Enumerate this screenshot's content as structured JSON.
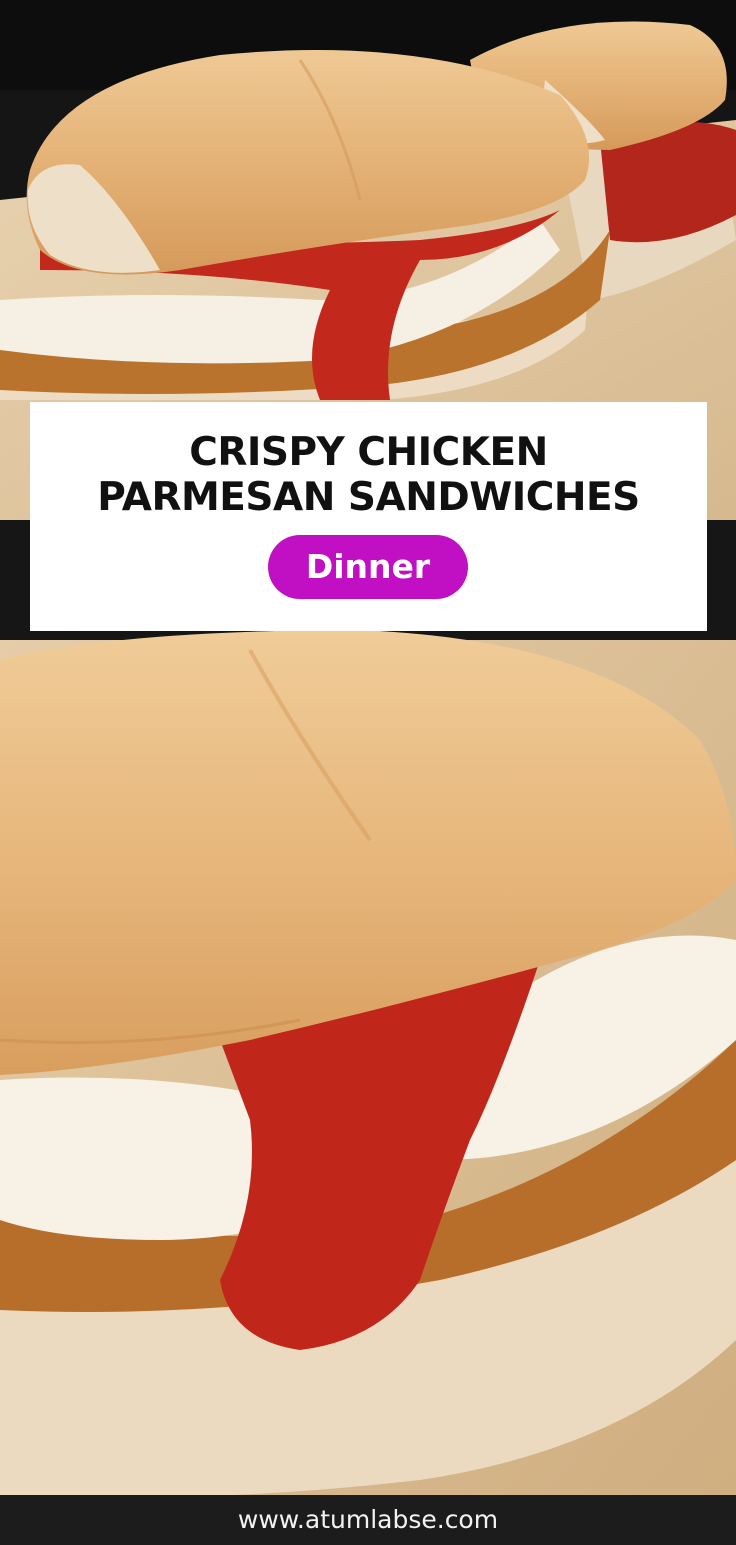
{
  "title": {
    "line1": "CRISPY CHICKEN",
    "line2": "PARMESAN SANDWICHES"
  },
  "category_badge": "Dinner",
  "footer": {
    "website": "www.atumlabse.com"
  },
  "colors": {
    "badge": "#c10fc4",
    "title_text": "#111111",
    "footer_bg": "#1c1c1c"
  },
  "images": {
    "top_photo": "chicken-parmesan-sandwiches-photo",
    "bottom_photo": "chicken-parmesan-sandwich-closeup-photo"
  }
}
